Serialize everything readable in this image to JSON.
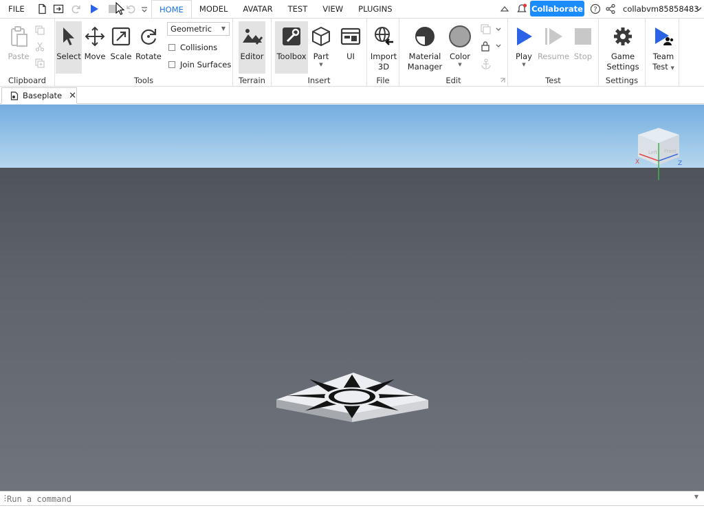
{
  "menubar": {
    "file": "FILE",
    "tabs": [
      "HOME",
      "MODEL",
      "AVATAR",
      "TEST",
      "VIEW",
      "PLUGINS"
    ],
    "active_tab": "HOME",
    "collaborate": "Collaborate",
    "username": "collabvm85858483"
  },
  "ribbon": {
    "clipboard": {
      "label": "Clipboard",
      "paste": "Paste"
    },
    "tools": {
      "label": "Tools",
      "select": "Select",
      "move": "Move",
      "scale": "Scale",
      "rotate": "Rotate",
      "mode_value": "Geometric",
      "collisions": "Collisions",
      "join_surfaces": "Join Surfaces"
    },
    "terrain": {
      "label": "Terrain",
      "editor": "Editor"
    },
    "insert": {
      "label": "Insert",
      "toolbox": "Toolbox",
      "part": "Part",
      "ui": "UI"
    },
    "file": {
      "label": "File",
      "import_line1": "Import",
      "import_line2": "3D"
    },
    "edit": {
      "label": "Edit",
      "material_line1": "Material",
      "material_line2": "Manager",
      "color": "Color"
    },
    "test": {
      "label": "Test",
      "play": "Play",
      "resume": "Resume",
      "stop": "Stop"
    },
    "settings": {
      "label": "Settings",
      "game_line1": "Game",
      "game_line2": "Settings"
    },
    "team": {
      "line1": "Team",
      "line2": "Test"
    }
  },
  "doc_tab": {
    "title": "Baseplate"
  },
  "command_bar": {
    "placeholder": "Run a command"
  },
  "colors": {
    "accent": "#1a73e8",
    "collaborate": "#1a8cff",
    "play": "#2b63e6",
    "sky_top": "#74aee0",
    "ground": "#6c7079"
  }
}
